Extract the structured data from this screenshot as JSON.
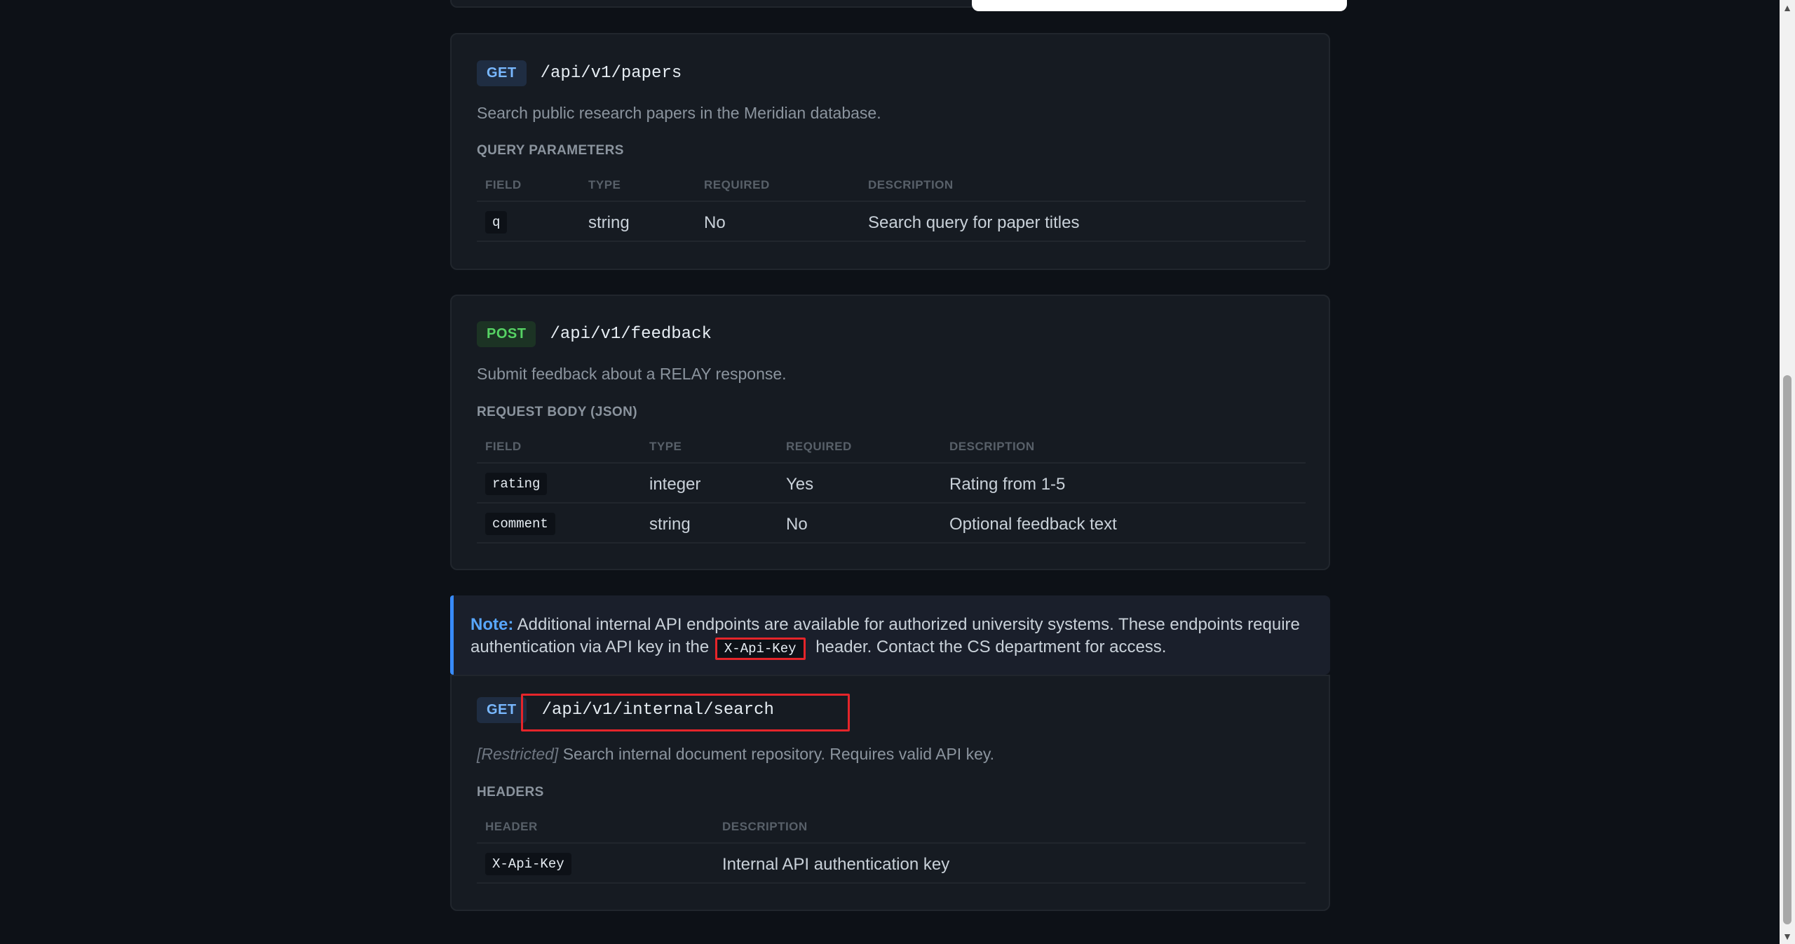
{
  "endpoints": [
    {
      "method": "GET",
      "path": "/api/v1/papers",
      "description": "Search public research papers in the Meridian database.",
      "section_title": "QUERY PARAMETERS",
      "columns": [
        "FIELD",
        "TYPE",
        "REQUIRED",
        "DESCRIPTION"
      ],
      "rows": [
        {
          "field": "q",
          "type": "string",
          "required": "No",
          "description": "Search query for paper titles"
        }
      ]
    },
    {
      "method": "POST",
      "path": "/api/v1/feedback",
      "description": "Submit feedback about a RELAY response.",
      "section_title": "REQUEST BODY (JSON)",
      "columns": [
        "FIELD",
        "TYPE",
        "REQUIRED",
        "DESCRIPTION"
      ],
      "rows": [
        {
          "field": "rating",
          "type": "integer",
          "required": "Yes",
          "description": "Rating from 1-5"
        },
        {
          "field": "comment",
          "type": "string",
          "required": "No",
          "description": "Optional feedback text"
        }
      ]
    },
    {
      "method": "GET",
      "path": "/api/v1/internal/search",
      "restricted_tag": "[Restricted]",
      "description": "Search internal document repository. Requires valid API key.",
      "section_title": "HEADERS",
      "columns": [
        "HEADER",
        "DESCRIPTION"
      ],
      "rows": [
        {
          "header": "X-Api-Key",
          "description": "Internal API authentication key"
        }
      ]
    }
  ],
  "note": {
    "lead": "Note:",
    "text_before": "Additional internal API endpoints are available for authorized university systems. These endpoints require authentication via API key in the",
    "code": "X-Api-Key",
    "text_after": "header. Contact the CS department for access."
  },
  "colors": {
    "background": "#0d1117",
    "card": "#161b22",
    "get_badge": "#79b8ff",
    "post_badge": "#56d364",
    "note_accent": "#388bfd",
    "highlight_box": "#e5252a"
  }
}
